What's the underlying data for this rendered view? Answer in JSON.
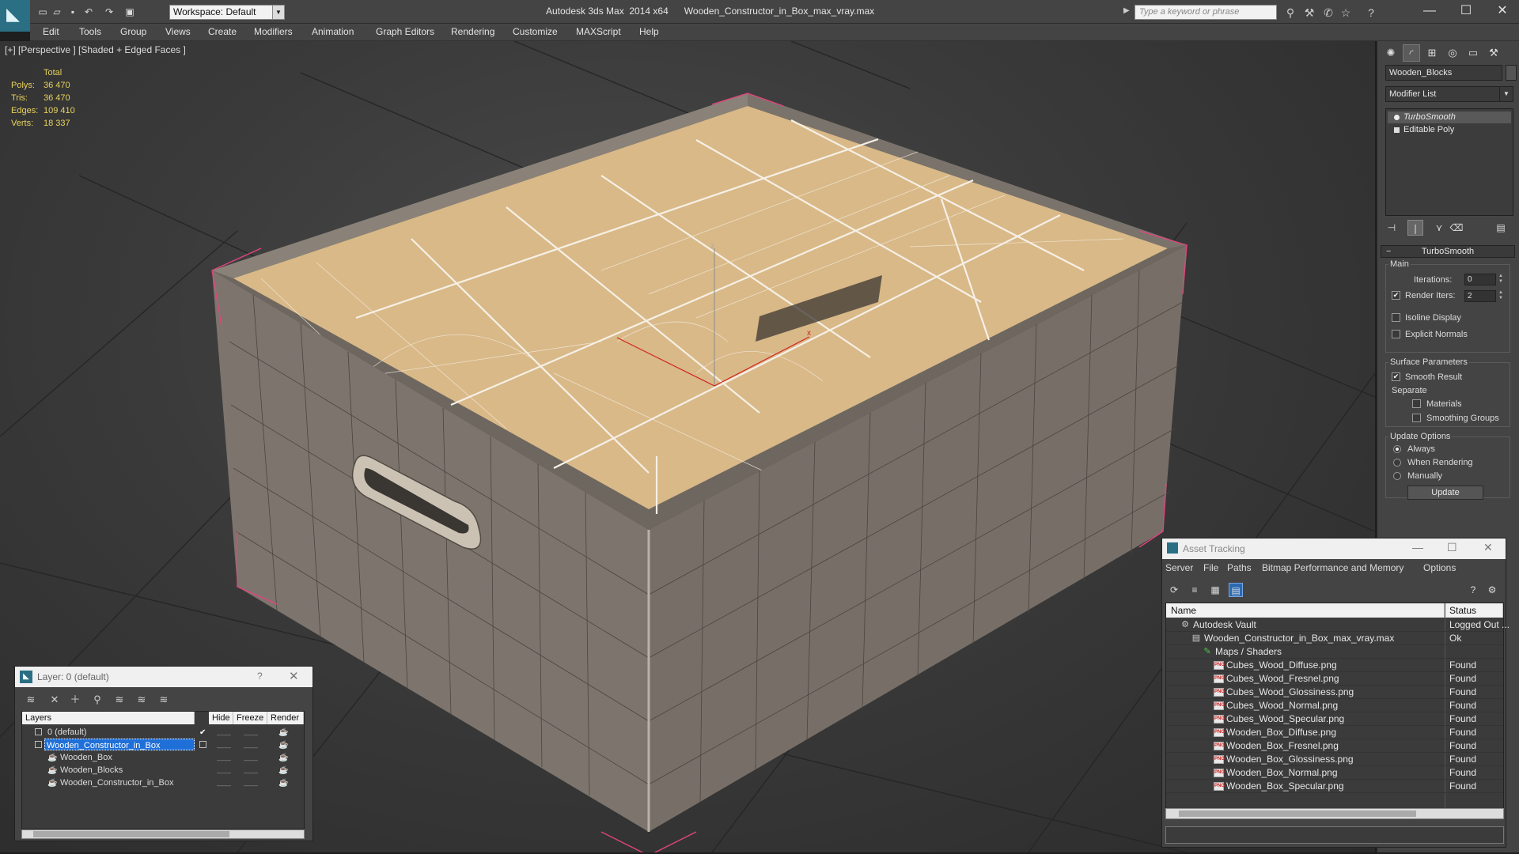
{
  "titlebar": {
    "app_title": "Autodesk 3ds Max  2014 x64",
    "file_title": "Wooden_Constructor_in_Box_max_vray.max",
    "workspace_value": "Workspace: Default",
    "search_placeholder": "Type a keyword or phrase"
  },
  "menu": [
    "Edit",
    "Tools",
    "Group",
    "Views",
    "Create",
    "Modifiers",
    "Animation",
    "Graph Editors",
    "Rendering",
    "Customize",
    "MAXScript",
    "Help"
  ],
  "viewport": {
    "label": "[+] [Perspective ] [Shaded + Edged Faces ]",
    "stats_header": "Total",
    "stats": [
      {
        "label": "Polys:",
        "value": "36 470"
      },
      {
        "label": "Tris:",
        "value": "36 470"
      },
      {
        "label": "Edges:",
        "value": "109 410"
      },
      {
        "label": "Verts:",
        "value": "18 337"
      }
    ]
  },
  "command_panel": {
    "object_name": "Wooden_Blocks",
    "modifier_list": "Modifier List",
    "stack": [
      "TurboSmooth",
      "Editable Poly"
    ],
    "rollout_title": "TurboSmooth",
    "main_group": "Main",
    "iterations_label": "Iterations:",
    "iterations_value": "0",
    "render_iters_label": "Render Iters:",
    "render_iters_value": "2",
    "render_iters_checked": true,
    "isoline_label": "Isoline Display",
    "explicit_normals_label": "Explicit Normals",
    "surface_group": "Surface Parameters",
    "smooth_result_label": "Smooth Result",
    "separate_label": "Separate",
    "materials_label": "Materials",
    "smoothing_groups_label": "Smoothing Groups",
    "update_group": "Update Options",
    "update_options": [
      "Always",
      "When Rendering",
      "Manually"
    ],
    "update_selected": "Always",
    "update_button": "Update"
  },
  "layer_dialog": {
    "title": "Layer: 0 (default)",
    "help": "?",
    "columns": [
      "Layers",
      "Hide",
      "Freeze",
      "Render"
    ],
    "rows": [
      {
        "name": "0 (default)",
        "indent": 1,
        "current": true
      },
      {
        "name": "Wooden_Constructor_in_Box",
        "indent": 1,
        "selected": true
      },
      {
        "name": "Wooden_Box",
        "indent": 2
      },
      {
        "name": "Wooden_Blocks",
        "indent": 2
      },
      {
        "name": "Wooden_Constructor_in_Box",
        "indent": 2
      }
    ]
  },
  "asset_tracking": {
    "title": "Asset Tracking",
    "menu": [
      "Server",
      "File",
      "Paths",
      "Bitmap Performance and Memory",
      "Options"
    ],
    "columns": [
      "Name",
      "Status"
    ],
    "rows": [
      {
        "name": "Autodesk Vault",
        "status": "Logged Out ...",
        "indent": 1,
        "icon": "vault"
      },
      {
        "name": "Wooden_Constructor_in_Box_max_vray.max",
        "status": "Ok",
        "indent": 2,
        "icon": "max"
      },
      {
        "name": "Maps / Shaders",
        "status": "",
        "indent": 3,
        "icon": "maps"
      },
      {
        "name": "Cubes_Wood_Diffuse.png",
        "status": "Found",
        "indent": 4,
        "icon": "png"
      },
      {
        "name": "Cubes_Wood_Fresnel.png",
        "status": "Found",
        "indent": 4,
        "icon": "png"
      },
      {
        "name": "Cubes_Wood_Glossiness.png",
        "status": "Found",
        "indent": 4,
        "icon": "png"
      },
      {
        "name": "Cubes_Wood_Normal.png",
        "status": "Found",
        "indent": 4,
        "icon": "png"
      },
      {
        "name": "Cubes_Wood_Specular.png",
        "status": "Found",
        "indent": 4,
        "icon": "png"
      },
      {
        "name": "Wooden_Box_Diffuse.png",
        "status": "Found",
        "indent": 4,
        "icon": "png"
      },
      {
        "name": "Wooden_Box_Fresnel.png",
        "status": "Found",
        "indent": 4,
        "icon": "png"
      },
      {
        "name": "Wooden_Box_Glossiness.png",
        "status": "Found",
        "indent": 4,
        "icon": "png"
      },
      {
        "name": "Wooden_Box_Normal.png",
        "status": "Found",
        "indent": 4,
        "icon": "png"
      },
      {
        "name": "Wooden_Box_Specular.png",
        "status": "Found",
        "indent": 4,
        "icon": "png"
      }
    ]
  },
  "colors": {
    "stats_yellow": "#e8d25e",
    "selection_blue": "#1f6fd8",
    "wood": "#d9b988",
    "box_grey": "#7d756d",
    "selection_bracket": "#e0457e"
  }
}
